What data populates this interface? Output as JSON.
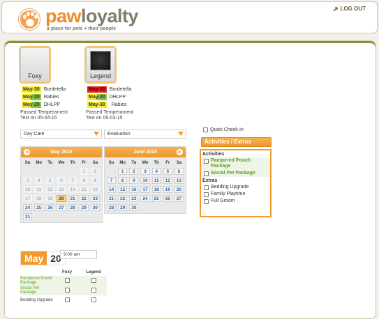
{
  "header": {
    "brand_part1": "paw",
    "brand_part2": "loyalty",
    "tagline": "a place for pets + their people",
    "logout_label": "LOG OUT"
  },
  "pets": [
    {
      "name": "Foxy",
      "vaccinations": [
        {
          "date": "May-30",
          "name": "Bordetella",
          "status": "yellow"
        },
        {
          "date": "May-20",
          "name": "Rabies",
          "status": "green"
        },
        {
          "date": "May-20",
          "name": "DHLPP",
          "status": "green"
        }
      ],
      "temperament": "Passed Temperament Test on 05-04-15"
    },
    {
      "name": "Legend",
      "vaccinations": [
        {
          "date": "May-30",
          "name": "Bordetella",
          "status": "red"
        },
        {
          "date": "May-20",
          "name": "DHLPP",
          "status": "green"
        },
        {
          "date": "May-30",
          "name": "Rabies",
          "status": "yellow"
        }
      ],
      "temperament": "Passed Temperament Test on 05-03-15"
    }
  ],
  "service_select": "Day Care",
  "evaluation_select": "Evaluation",
  "weekday_labels": [
    "Su",
    "Mo",
    "Tu",
    "We",
    "Th",
    "Fr",
    "Sa"
  ],
  "calendars": [
    {
      "title": "May 2015",
      "weeks": [
        [
          "",
          "",
          "",
          "",
          "",
          "1",
          "2"
        ],
        [
          "3",
          "4",
          "5",
          "6",
          "7",
          "8",
          "9"
        ],
        [
          "10",
          "11",
          "12",
          "13",
          "14",
          "15",
          "16"
        ],
        [
          "17",
          "18",
          "19",
          "20",
          "21",
          "22",
          "23"
        ],
        [
          "24",
          "25",
          "26",
          "27",
          "28",
          "29",
          "30"
        ],
        [
          "31",
          "",
          "",
          "",
          "",
          "",
          ""
        ]
      ],
      "selected_day": "20",
      "first_active_day": 20
    },
    {
      "title": "June 2015",
      "weeks": [
        [
          "",
          "1",
          "2",
          "3",
          "4",
          "5",
          "6"
        ],
        [
          "7",
          "8",
          "9",
          "10",
          "11",
          "12",
          "13"
        ],
        [
          "14",
          "15",
          "16",
          "17",
          "18",
          "19",
          "20"
        ],
        [
          "21",
          "22",
          "23",
          "24",
          "25",
          "26",
          "27"
        ],
        [
          "28",
          "29",
          "30",
          "",
          "",
          "",
          ""
        ]
      ],
      "selected_day": "",
      "first_active_day": 1
    }
  ],
  "quick_checkin_label": "Quick Check-In",
  "activities_button_label": "Activities / Extras",
  "activities_panel": {
    "activities_header": "Activities",
    "activities": [
      "Pampered Pooch Package",
      "Social Pet Package"
    ],
    "extras_header": "Extras",
    "extras": [
      "Bedding Upgrade",
      "Family Playtime",
      "Full Groom"
    ]
  },
  "selected_date": {
    "month": "May",
    "day": "20"
  },
  "time_value": "9:00 am",
  "schedule": {
    "pet_columns": [
      "Foxy",
      "Legend"
    ],
    "rows": [
      {
        "label": "Pampered Pooch Package",
        "type": "activity"
      },
      {
        "label": "Social Pet Package",
        "type": "activity"
      },
      {
        "label": "Bedding Upgrade",
        "type": "extra"
      }
    ]
  },
  "colors": {
    "accent_orange": "#f29b28",
    "activity_green": "#5c9c2a"
  }
}
